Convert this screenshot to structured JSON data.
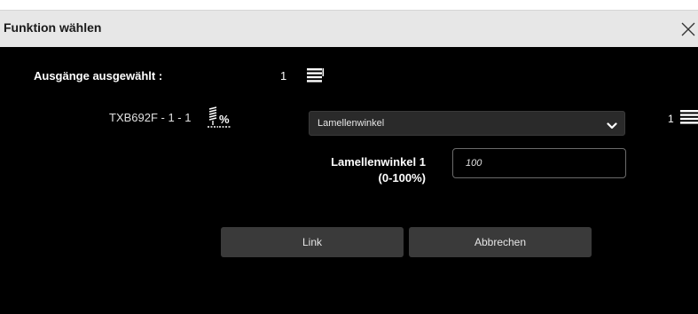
{
  "dialog": {
    "title": "Funktion wählen"
  },
  "selection": {
    "label": "Ausgänge ausgewählt :",
    "count": "1",
    "icon": "blinds-icon"
  },
  "device": {
    "name": "TXB692F - 1 - 1",
    "icon": "blinds-percent-icon",
    "function_select": {
      "selected": "Lamellenwinkel"
    },
    "right_count": "1"
  },
  "parameter": {
    "label_line1": "Lamellenwinkel 1",
    "label_line2": "(0-100%)",
    "value": "100"
  },
  "buttons": {
    "link": "Link",
    "cancel": "Abbrechen"
  }
}
